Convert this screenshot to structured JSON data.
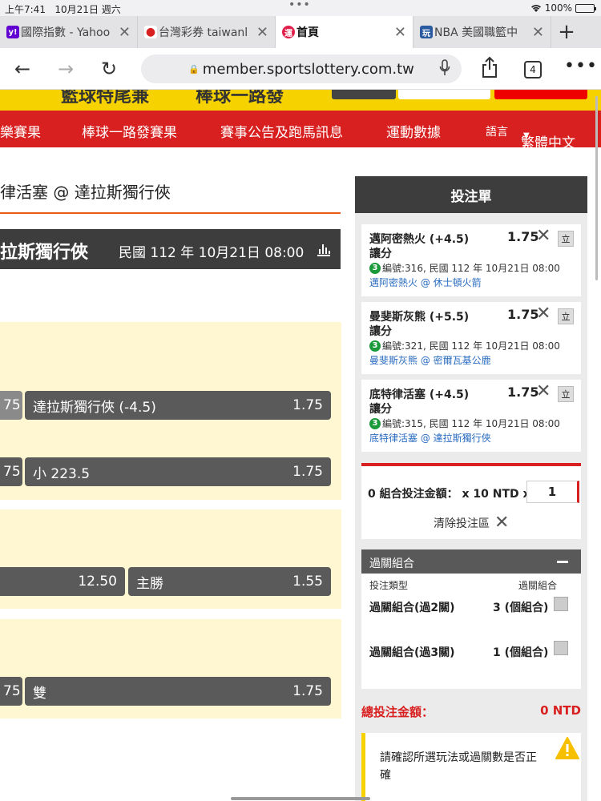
{
  "status": {
    "time": "上午7:41",
    "date": "10月21日 週六",
    "battery": "100%"
  },
  "browser": {
    "tabs": [
      {
        "label": "國際指數 - Yahoo",
        "favicon": "y!",
        "fav_color": "#6001d2"
      },
      {
        "label": "台灣彩券 taiwanl",
        "favicon": "●",
        "fav_color": "#d92020"
      },
      {
        "label": "首頁",
        "favicon": "運",
        "fav_color": "#e0204a"
      },
      {
        "label": "NBA 美國職籃中",
        "favicon": "玩",
        "fav_color": "#2a5aa0"
      }
    ],
    "url": "member.sportslottery.com.tw",
    "tab_count": "4"
  },
  "site": {
    "banner": {
      "left": "籃球特尾兼",
      "mid": "棒球一路發"
    },
    "nav": [
      "樂賽果",
      "棒球一路發賽果",
      "賽事公告及跑馬訊息",
      "運動數據",
      "語言",
      "繁體中文"
    ]
  },
  "match": {
    "title": "律活塞 @ 達拉斯獨行俠",
    "bar_team": "拉斯獨行俠",
    "bar_date": "民國 112 年 10月21日 08:00"
  },
  "odds": [
    {
      "left_stub": "75",
      "label": "達拉斯獨行俠 (-4.5)",
      "value": "1.75"
    },
    {
      "left_stub": "75",
      "label": "小 223.5",
      "value": "1.75"
    },
    {
      "left_val": "12.50",
      "label": "主勝",
      "value": "1.55"
    },
    {
      "left_stub": "75",
      "label": "雙",
      "value": "1.75"
    }
  ],
  "betslip": {
    "title": "投注單",
    "selections": [
      {
        "title": "邁阿密熱火 (+4.5)",
        "type": "讓分",
        "odds": "1.75",
        "num": "3",
        "info": "編號:316, 民國 112 年 10月21日  08:00",
        "match": "邁阿密熱火 @ 休士頓火箭",
        "btn": "立"
      },
      {
        "title": "曼斐斯灰熊 (+5.5)",
        "type": "讓分",
        "odds": "1.75",
        "num": "3",
        "info": "編號:321, 民國 112 年 10月21日  08:00",
        "match": "曼斐斯灰熊 @ 密爾瓦基公鹿",
        "btn": "立"
      },
      {
        "title": "底特律活塞 (+4.5)",
        "type": "讓分",
        "odds": "1.75",
        "num": "3",
        "info": "編號:315, 民國 112 年 10月21日  08:00",
        "match": "底特律活塞 @ 達拉斯獨行俠",
        "btn": "立"
      }
    ],
    "stake_text": "0 組合投注金額： x 10 NTD x",
    "stake_value": "1",
    "clear_label": "清除投注區",
    "parlay": {
      "title": "過關組合",
      "col_type": "投注類型",
      "col_combo": "過關組合",
      "rows": [
        {
          "label": "過關組合(過2關)",
          "count": "3 (個組合)"
        },
        {
          "label": "過關組合(過3關)",
          "count": "1 (個組合)"
        }
      ]
    },
    "total_label": "總投注金額：",
    "total_value": "0 NTD",
    "warning": "請確認所選玩法或過關數是否正確"
  }
}
